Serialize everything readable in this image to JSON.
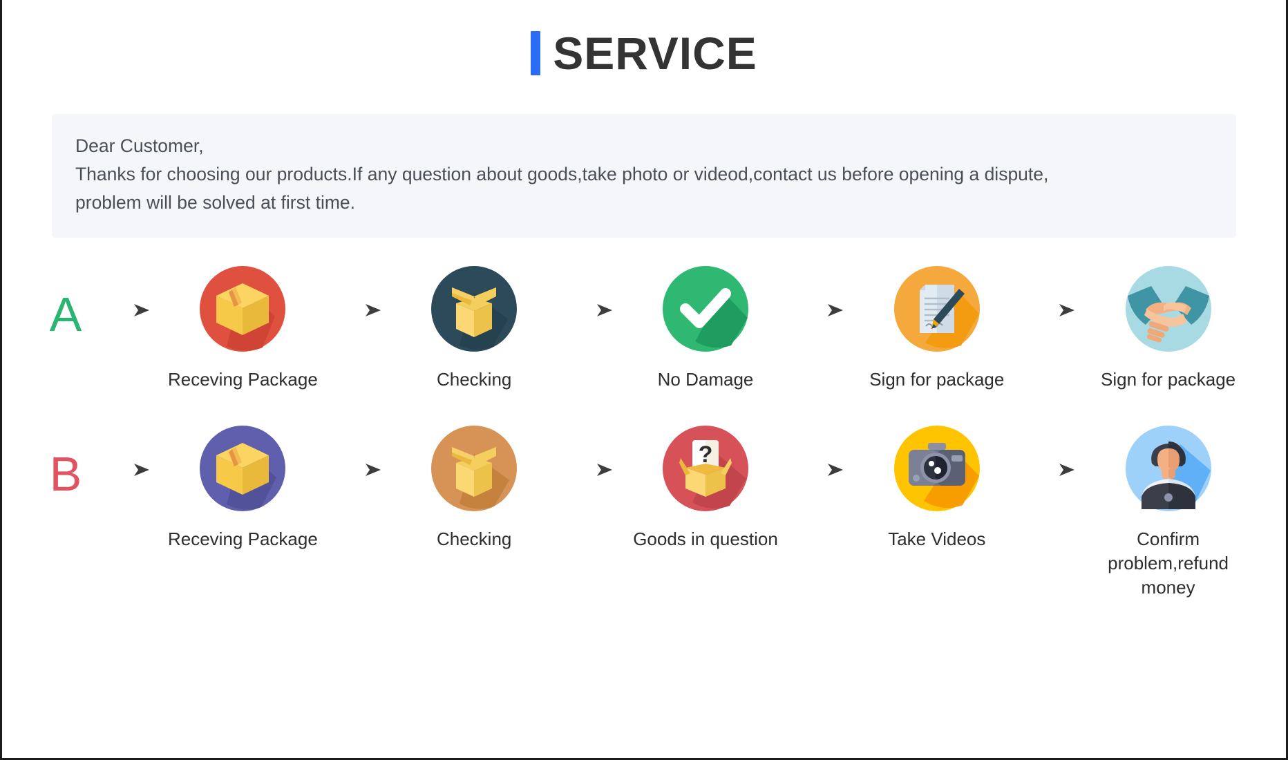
{
  "header": {
    "title": "SERVICE",
    "accent_color": "#2b6cf5"
  },
  "notice": {
    "line1": "Dear Customer,",
    "line2": "Thanks for choosing our products.If any question about goods,take photo or videod,contact us before opening a dispute,",
    "line3": "problem will be solved at first time.",
    "background_color": "#f4f6fa"
  },
  "flows": [
    {
      "badge": "A",
      "badge_color": "#2ab573",
      "steps": [
        {
          "label": "Receving Package",
          "icon": "closed-box-icon",
          "circle_color": "#e0503f"
        },
        {
          "label": "Checking",
          "icon": "open-box-icon",
          "circle_color": "#2c4a5a"
        },
        {
          "label": "No Damage",
          "icon": "check-mark-icon",
          "circle_color": "#2eb872"
        },
        {
          "label": "Sign for package",
          "icon": "document-pen-icon",
          "circle_color": "#f5a93c"
        },
        {
          "label": "Sign for package",
          "icon": "handshake-icon",
          "circle_color": "#a8dae4"
        }
      ]
    },
    {
      "badge": "B",
      "badge_color": "#e15361",
      "steps": [
        {
          "label": "Receving Package",
          "icon": "closed-box-icon",
          "circle_color": "#5f5fad"
        },
        {
          "label": "Checking",
          "icon": "open-box-icon",
          "circle_color": "#d79355"
        },
        {
          "label": "Goods in question",
          "icon": "question-box-icon",
          "circle_color": "#d65158"
        },
        {
          "label": "Take Videos",
          "icon": "camera-icon",
          "circle_color": "#fec400"
        },
        {
          "label": "Confirm problem,refund money",
          "icon": "support-person-icon",
          "circle_color": "#9dd1fa"
        }
      ]
    }
  ],
  "arrow": {
    "icon": "arrow-right-icon",
    "color": "#4a4a4a"
  }
}
